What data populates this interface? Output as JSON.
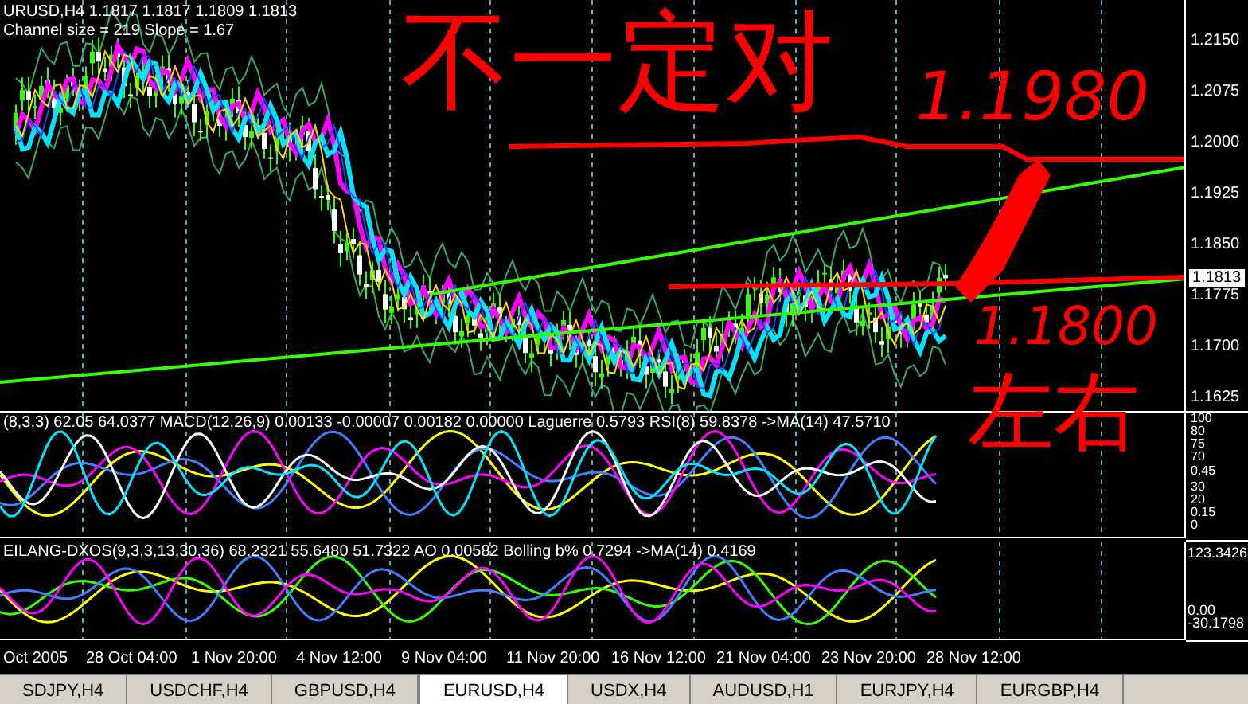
{
  "main_chart": {
    "symbol_line": "URUSD,H4  1.1817 1.1817 1.1809 1.1813",
    "channel_line": "Channel size = 219 Slope = 1.67",
    "price_ticks": [
      "1.2150",
      "1.2075",
      "1.2000",
      "1.1925",
      "1.1850",
      "1.1775",
      "1.1700",
      "1.1625"
    ],
    "current_price": "1.1813"
  },
  "indicator_1": {
    "legend": "(8,3,3) 62.05 64.0377  MACD(12,26,9) 0.00133 -0.00007 0.00182 0.00000  Laguerre 0.5793  RSI(8) 59.8378  ->MA(14) 47.5710",
    "ticks": [
      "100",
      "80",
      "75",
      "70",
      "0.45",
      "30",
      "20",
      "0.15",
      "0"
    ]
  },
  "indicator_2": {
    "legend": "EILANG-DXOS(9,3,3,13,30,36) 68.2321 55.6480 51.7322  AO 0.00582  Bolling b%  0.7294  ->MA(14) 0.4169",
    "ticks": [
      "123.3426",
      "0.00",
      "-30.1798"
    ]
  },
  "time_axis": {
    "labels": [
      "Oct 2005",
      "28 Oct 04:00",
      "1 Nov 20:00",
      "4 Nov 12:00",
      "9 Nov 04:00",
      "11 Nov 20:00",
      "16 Nov 12:00",
      "21 Nov 04:00",
      "23 Nov 20:00",
      "28 Nov 12:00"
    ]
  },
  "tabs": [
    {
      "label": "SDJPY,H4",
      "selected": false
    },
    {
      "label": "USDCHF,H4",
      "selected": false
    },
    {
      "label": "GBPUSD,H4",
      "selected": false
    },
    {
      "label": "EURUSD,H4",
      "selected": true
    },
    {
      "label": "USDX,H4",
      "selected": false
    },
    {
      "label": "AUDUSD,H1",
      "selected": false
    },
    {
      "label": "EURJPY,H4",
      "selected": false
    },
    {
      "label": "EURGBP,H4",
      "selected": false
    }
  ],
  "annotations": [
    {
      "text": "不一定对"
    },
    {
      "text": "1.1980"
    },
    {
      "text": "1.1800"
    },
    {
      "text": "左右"
    }
  ]
}
